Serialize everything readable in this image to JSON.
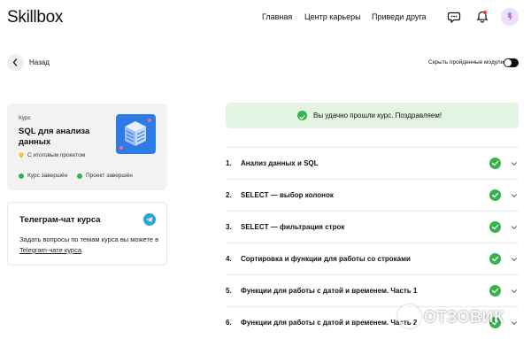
{
  "header": {
    "logo": "Skillbox",
    "nav": [
      "Главная",
      "Центр карьеры",
      "Приведи друга"
    ],
    "icons": [
      "chat-icon",
      "bell-icon",
      "avatar"
    ]
  },
  "toolbar": {
    "back_label": "Назад",
    "hide_completed_label": "Скрыть пройденные модули",
    "hide_completed_on": true
  },
  "course_card": {
    "kicker": "Курс",
    "title": "SQL для анализа данных",
    "subtitle": "С итоговым проектом",
    "status_course": "Курс завершён",
    "status_project": "Проект завершён",
    "status_color": "#36b24a"
  },
  "telegram_card": {
    "title": "Телеграм-чат курса",
    "text_before": "Задать вопросы по темам курса вы можете в ",
    "link_text": "Telegram-чате курса",
    "text_after": "."
  },
  "success_banner": {
    "text": "Вы удачно прошли курс. Поздравляем!",
    "background": "#e3f4e3"
  },
  "modules": [
    {
      "num": "1.",
      "title": "Анализ данных и SQL",
      "done": true
    },
    {
      "num": "2.",
      "title": "SELECT — выбор колонок",
      "done": true
    },
    {
      "num": "3.",
      "title": "SELECT — фильтрация строк",
      "done": true
    },
    {
      "num": "4.",
      "title": "Сортировка и функции для работы со строками",
      "done": true
    },
    {
      "num": "5.",
      "title": "Функции для работы с датой и временем. Часть 1",
      "done": true
    },
    {
      "num": "6.",
      "title": "Функции для работы с датой и временем. Часть 2",
      "done": true
    }
  ],
  "watermark": "ОТЗОВИК"
}
